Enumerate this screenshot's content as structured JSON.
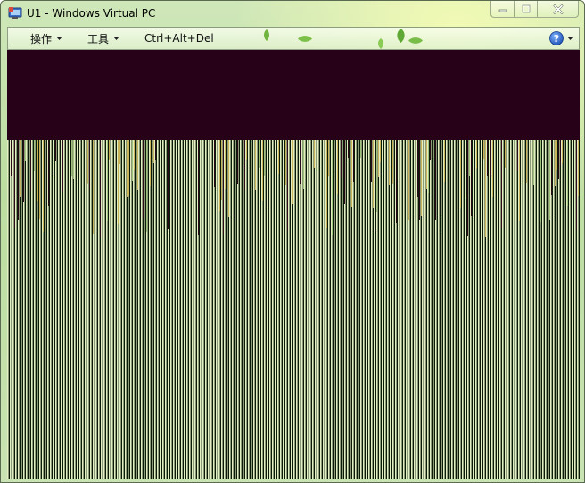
{
  "window": {
    "title": "U1 - Windows Virtual PC"
  },
  "toolbar": {
    "menus": [
      {
        "label": "操作"
      },
      {
        "label": "工具"
      }
    ],
    "cad_label": "Ctrl+Alt+Del",
    "help_icon": "help-icon"
  },
  "colors": {
    "screen_dark": "#270118",
    "stripe_light": "#e3efc2",
    "stripe_dark": "#0a1a08"
  }
}
